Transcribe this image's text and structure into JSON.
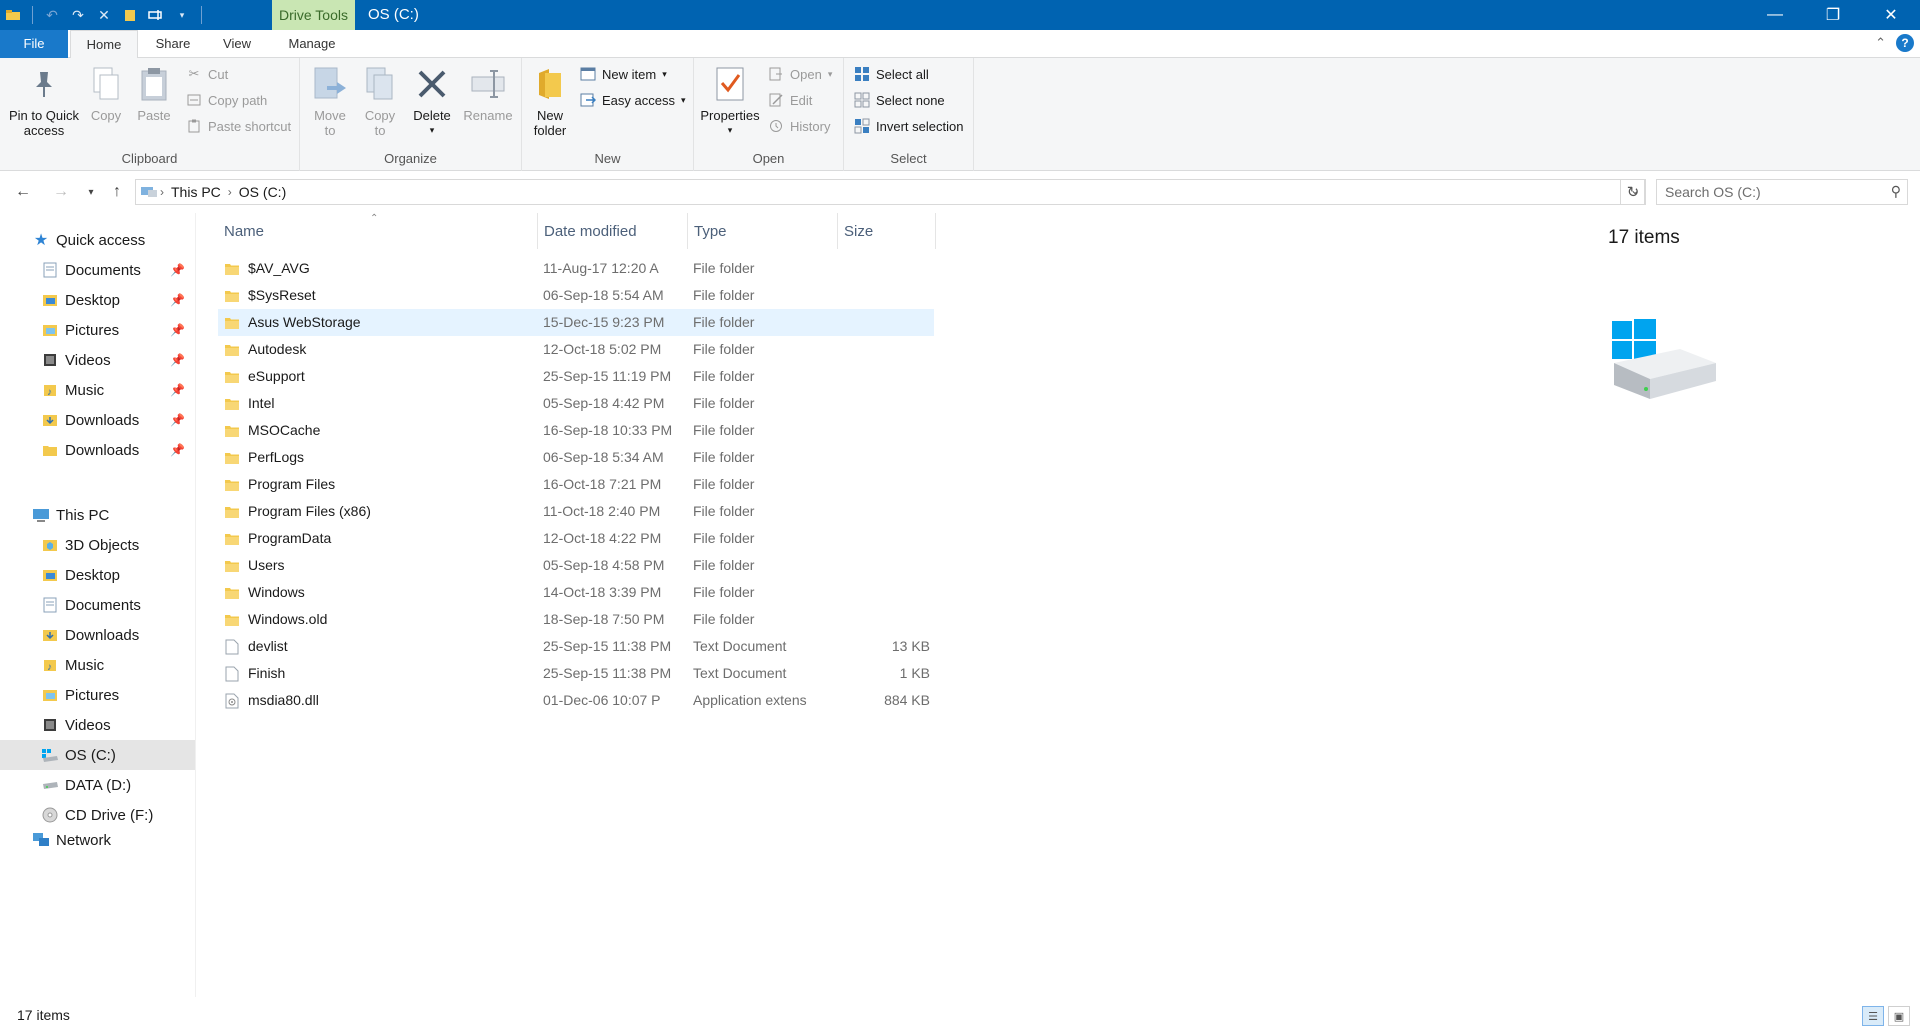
{
  "window": {
    "title": "OS (C:)",
    "contextual_tab": "Drive Tools",
    "accent": "#0063b1"
  },
  "ribbon_tabs": [
    "File",
    "Home",
    "Share",
    "View",
    "Manage"
  ],
  "ribbon": {
    "clipboard": {
      "label": "Clipboard",
      "pin_line1": "Pin to Quick",
      "pin_line2": "access",
      "copy": "Copy",
      "paste": "Paste",
      "cut": "Cut",
      "copy_path": "Copy path",
      "paste_shortcut": "Paste shortcut"
    },
    "organize": {
      "label": "Organize",
      "move_line1": "Move",
      "move_line2": "to",
      "copy_line1": "Copy",
      "copy_line2": "to",
      "delete": "Delete",
      "rename": "Rename"
    },
    "new": {
      "label": "New",
      "folder_line1": "New",
      "folder_line2": "folder",
      "new_item": "New item",
      "easy_access": "Easy access"
    },
    "open": {
      "label": "Open",
      "properties": "Properties",
      "open": "Open",
      "edit": "Edit",
      "history": "History"
    },
    "select": {
      "label": "Select",
      "select_all": "Select all",
      "select_none": "Select none",
      "invert": "Invert selection"
    }
  },
  "address": {
    "crumbs": [
      "This PC",
      "OS (C:)"
    ],
    "search_placeholder": "Search OS (C:)"
  },
  "navpane": {
    "quick_access": "Quick access",
    "quick_items": [
      {
        "label": "Documents",
        "icon": "documents-icon",
        "pinned": true
      },
      {
        "label": "Desktop",
        "icon": "desktop-folder-icon",
        "pinned": true
      },
      {
        "label": "Pictures",
        "icon": "pictures-icon",
        "pinned": true
      },
      {
        "label": "Videos",
        "icon": "videos-icon",
        "pinned": true
      },
      {
        "label": "Music",
        "icon": "music-icon",
        "pinned": true
      },
      {
        "label": "Downloads",
        "icon": "downloads-icon",
        "pinned": true
      },
      {
        "label": "Downloads",
        "icon": "folder-icon",
        "pinned": true
      }
    ],
    "this_pc": "This PC",
    "pc_items": [
      {
        "label": "3D Objects",
        "icon": "3d-objects-icon"
      },
      {
        "label": "Desktop",
        "icon": "desktop-folder-icon"
      },
      {
        "label": "Documents",
        "icon": "documents-icon"
      },
      {
        "label": "Downloads",
        "icon": "downloads-icon"
      },
      {
        "label": "Music",
        "icon": "music-icon"
      },
      {
        "label": "Pictures",
        "icon": "pictures-icon"
      },
      {
        "label": "Videos",
        "icon": "videos-icon"
      },
      {
        "label": "OS (C:)",
        "icon": "os-drive-icon",
        "selected": true
      },
      {
        "label": "DATA (D:)",
        "icon": "drive-icon"
      },
      {
        "label": "CD Drive (F:)",
        "icon": "cd-drive-icon"
      }
    ],
    "network": "Network"
  },
  "columns": {
    "name": "Name",
    "date": "Date modified",
    "type": "Type",
    "size": "Size"
  },
  "files": [
    {
      "name": "$AV_AVG",
      "date": "11-Aug-17 12:20 A",
      "type": "File folder",
      "size": "",
      "icon": "folder"
    },
    {
      "name": "$SysReset",
      "date": "06-Sep-18 5:54 AM",
      "type": "File folder",
      "size": "",
      "icon": "folder"
    },
    {
      "name": "Asus WebStorage",
      "date": "15-Dec-15 9:23 PM",
      "type": "File folder",
      "size": "",
      "icon": "folder",
      "hover": true
    },
    {
      "name": "Autodesk",
      "date": "12-Oct-18 5:02 PM",
      "type": "File folder",
      "size": "",
      "icon": "folder"
    },
    {
      "name": "eSupport",
      "date": "25-Sep-15 11:19 PM",
      "type": "File folder",
      "size": "",
      "icon": "folder"
    },
    {
      "name": "Intel",
      "date": "05-Sep-18 4:42 PM",
      "type": "File folder",
      "size": "",
      "icon": "folder"
    },
    {
      "name": "MSOCache",
      "date": "16-Sep-18 10:33 PM",
      "type": "File folder",
      "size": "",
      "icon": "folder"
    },
    {
      "name": "PerfLogs",
      "date": "06-Sep-18 5:34 AM",
      "type": "File folder",
      "size": "",
      "icon": "folder"
    },
    {
      "name": "Program Files",
      "date": "16-Oct-18 7:21 PM",
      "type": "File folder",
      "size": "",
      "icon": "folder"
    },
    {
      "name": "Program Files (x86)",
      "date": "11-Oct-18 2:40 PM",
      "type": "File folder",
      "size": "",
      "icon": "folder"
    },
    {
      "name": "ProgramData",
      "date": "12-Oct-18 4:22 PM",
      "type": "File folder",
      "size": "",
      "icon": "folder"
    },
    {
      "name": "Users",
      "date": "05-Sep-18 4:58 PM",
      "type": "File folder",
      "size": "",
      "icon": "folder"
    },
    {
      "name": "Windows",
      "date": "14-Oct-18 3:39 PM",
      "type": "File folder",
      "size": "",
      "icon": "folder"
    },
    {
      "name": "Windows.old",
      "date": "18-Sep-18 7:50 PM",
      "type": "File folder",
      "size": "",
      "icon": "folder"
    },
    {
      "name": "devlist",
      "date": "25-Sep-15 11:38 PM",
      "type": "Text Document",
      "size": "13 KB",
      "icon": "text"
    },
    {
      "name": "Finish",
      "date": "25-Sep-15 11:38 PM",
      "type": "Text Document",
      "size": "1 KB",
      "icon": "text"
    },
    {
      "name": "msdia80.dll",
      "date": "01-Dec-06 10:07 P",
      "type": "Application extens",
      "size": "884 KB",
      "icon": "dll"
    }
  ],
  "details": {
    "count": "17 items"
  },
  "status": {
    "count": "17 items"
  }
}
